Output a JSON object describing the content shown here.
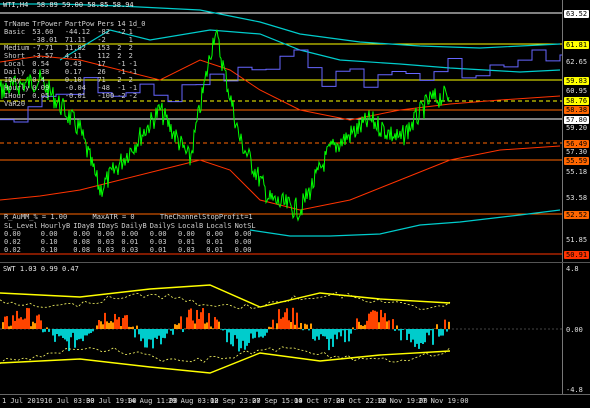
{
  "window": {
    "title": "WTI,H4  58.89 59.00 58.85 58.94"
  },
  "info_table": {
    "headers": [
      "TrName",
      "TrPower",
      "PartPow",
      "Pers",
      "14",
      "1d_0"
    ],
    "rows": [
      [
        "Basic",
        "53.60",
        "-44.12",
        "-82",
        "-2",
        "1"
      ],
      [
        "",
        "-38.01",
        "71.11",
        "-2",
        "",
        "1"
      ],
      [
        "Medium",
        "-7.71",
        "11.82",
        "153",
        "2",
        "2"
      ],
      [
        "Short",
        "-3.57",
        "4.11",
        "112",
        "2",
        "2"
      ],
      [
        "Local",
        "0.54",
        "0.43",
        "17",
        "-1",
        "-1"
      ],
      [
        "Daily",
        "0.38",
        "0.17",
        "26",
        "-1",
        "-1"
      ],
      [
        "IDay",
        "0.4",
        "0.10",
        "71",
        "2",
        "2"
      ],
      [
        "Hourly",
        "0.09",
        "-0.04",
        "-48",
        "-1",
        "-1"
      ],
      [
        "IHour",
        "0.05",
        "-0.01",
        "-100",
        "-2",
        "-2"
      ],
      [
        "VaR20",
        "",
        "",
        "",
        "",
        ""
      ]
    ]
  },
  "params_line": "R_AuMM_% = 1.00      MaxATR = 0      TheChannelStopProfit=1",
  "levels_table": {
    "headers": [
      "SL_Level",
      "HourlyB",
      "IDayB",
      "IDayS",
      "DailyB",
      "DailyS",
      "LocalB",
      "LocalS",
      "NotSL"
    ],
    "rows": [
      [
        "0.00",
        "0.00",
        "0.00",
        "0.00",
        "0.00",
        "0.00",
        "0.00",
        "0.00",
        "0.00"
      ],
      [
        "0.02",
        "0.10",
        "0.08",
        "0.03",
        "0.01",
        "0.03",
        "0.01",
        "0.01",
        "0.00"
      ],
      [
        "0.02",
        "0.10",
        "0.08",
        "0.03",
        "0.03",
        "0.01",
        "0.03",
        "0.01",
        "0.00"
      ]
    ]
  },
  "price_tags": [
    {
      "label": "63.52",
      "color": "#ffffff"
    },
    {
      "label": "61.81",
      "color": "#ffff00"
    },
    {
      "label": "59.83",
      "color": "#ffff00"
    },
    {
      "label": "58.76",
      "color": "#ffff00"
    },
    {
      "label": "58.38",
      "color": "#ff6600"
    },
    {
      "label": "57.80",
      "color": "#ffffff"
    },
    {
      "label": "56.49",
      "color": "#ff6600"
    },
    {
      "label": "55.59",
      "color": "#ff6600"
    },
    {
      "label": "52.52",
      "color": "#ff6600"
    },
    {
      "label": "50.91",
      "color": "#ff3300"
    }
  ],
  "price_scale": [
    "62.65",
    "60.95",
    "59.20",
    "57.30",
    "55.18",
    "53.58",
    "51.85"
  ],
  "sub_window": {
    "title": "SWT 1.03 0.99 0.47",
    "scale": [
      "4.8",
      "0.00",
      "-4.8"
    ]
  },
  "time_axis": [
    "1 Jul 2019",
    "16 Jul 03:00",
    "30 Jul 19:00",
    "14 Aug 11:00",
    "29 Aug 03:00",
    "12 Sep 23:00",
    "27 Sep 15:00",
    "14 Oct 07:00",
    "28 Oct 22:00",
    "12 Nov 19:00",
    "27 Nov 19:00"
  ],
  "colors": {
    "price_line": "#00ff00",
    "envelope": "#ff3300",
    "cyan_ma": "#00cccc",
    "blue_line": "#6666ff",
    "level_line": "#ffff00",
    "histogram_red": "#ff4400",
    "histogram_orange": "#ff9900",
    "histogram_cyan": "#00cccc"
  }
}
